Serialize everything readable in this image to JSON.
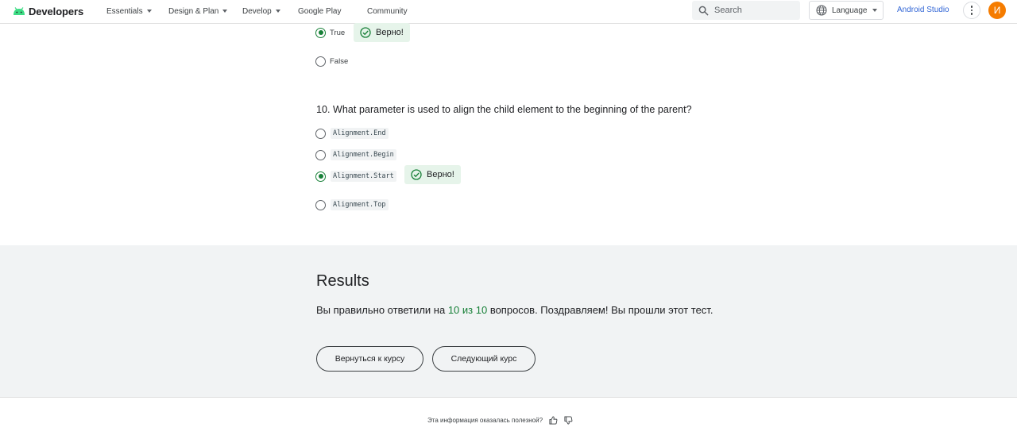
{
  "header": {
    "logo_text": "Developers",
    "nav": [
      {
        "label": "Essentials",
        "has_caret": true
      },
      {
        "label": "Design & Plan",
        "has_caret": true
      },
      {
        "label": "Develop",
        "has_caret": true
      },
      {
        "label": "Google Play",
        "has_caret": false
      },
      {
        "label": "Community",
        "has_caret": false
      }
    ],
    "search_placeholder": "Search",
    "language_label": "Language",
    "android_studio_label": "Android Studio",
    "avatar_initial": "И"
  },
  "quiz": {
    "prev_question": {
      "options": [
        {
          "label": "True",
          "selected": true,
          "correct_badge": "Верно!"
        },
        {
          "label": "False",
          "selected": false
        }
      ]
    },
    "question10": {
      "text": "10. What parameter is used to align the child element to the beginning of the parent?",
      "options": [
        {
          "label": "Alignment.End",
          "selected": false
        },
        {
          "label": "Alignment.Begin",
          "selected": false
        },
        {
          "label": "Alignment.Start",
          "selected": true,
          "correct_badge": "Верно!"
        },
        {
          "label": "Alignment.Top",
          "selected": false
        }
      ]
    }
  },
  "results": {
    "title": "Results",
    "text_before": "Вы правильно ответили на ",
    "score": "10 из 10",
    "text_after": " вопросов. Поздравляем! Вы прошли этот тест.",
    "back_button": "Вернуться к курсу",
    "next_button": "Следующий курс"
  },
  "footer": {
    "feedback_question": "Эта информация оказалась полезной?"
  },
  "colors": {
    "accent_green": "#188038",
    "badge_bg": "#e6f4ea",
    "avatar_bg": "#f57c00",
    "link_blue": "#3367d6",
    "results_bg": "#f1f3f4"
  }
}
